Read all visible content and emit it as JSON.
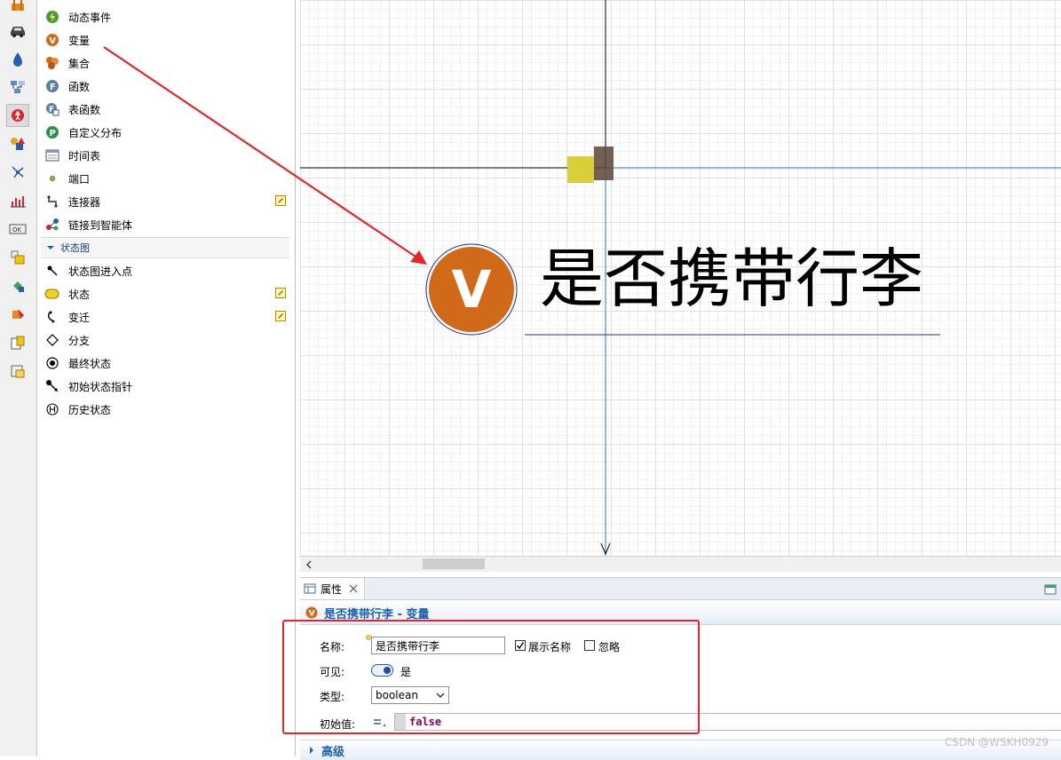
{
  "palette": {
    "items": [
      {
        "label": "动态事件",
        "icon": "dynamic-event-icon"
      },
      {
        "label": "变量",
        "icon": "variable-icon"
      },
      {
        "label": "集合",
        "icon": "collection-icon"
      },
      {
        "label": "函数",
        "icon": "function-icon"
      },
      {
        "label": "表函数",
        "icon": "table-function-icon"
      },
      {
        "label": "自定义分布",
        "icon": "custom-distribution-icon"
      },
      {
        "label": "时间表",
        "icon": "schedule-icon"
      },
      {
        "label": "端口",
        "icon": "port-icon"
      },
      {
        "label": "连接器",
        "icon": "connector-icon"
      },
      {
        "label": "链接到智能体",
        "icon": "link-to-agent-icon"
      }
    ],
    "section": "状态图",
    "statechart_items": [
      {
        "label": "状态图进入点",
        "icon": "statechart-entry-icon"
      },
      {
        "label": "状态",
        "icon": "state-icon"
      },
      {
        "label": "变迁",
        "icon": "transition-icon"
      },
      {
        "label": "分支",
        "icon": "branch-icon"
      },
      {
        "label": "最终状态",
        "icon": "final-state-icon"
      },
      {
        "label": "初始状态指针",
        "icon": "initial-state-pointer-icon"
      },
      {
        "label": "历史状态",
        "icon": "history-state-icon"
      }
    ]
  },
  "canvas": {
    "variable_letter": "V",
    "variable_name": "是否携带行李"
  },
  "properties": {
    "tab_label": "属性",
    "title": "是否携带行李 - 变量",
    "name_label": "名称:",
    "name_value": "是否携带行李",
    "show_name_label": "展示名称",
    "show_name_checked": true,
    "ignore_label": "忽略",
    "ignore_checked": false,
    "visible_label": "可见:",
    "visible_value": "是",
    "type_label": "类型:",
    "type_value": "boolean",
    "initial_label": "初始值:",
    "initial_value": "false",
    "advanced_label": "高级"
  },
  "watermark": "CSDN @WSKH0929",
  "colors": {
    "variable_orange": "#d06a18",
    "annotation_red": "#e3242b",
    "title_blue": "#1a5fb4",
    "guide_blue": "#2f6fb8"
  }
}
